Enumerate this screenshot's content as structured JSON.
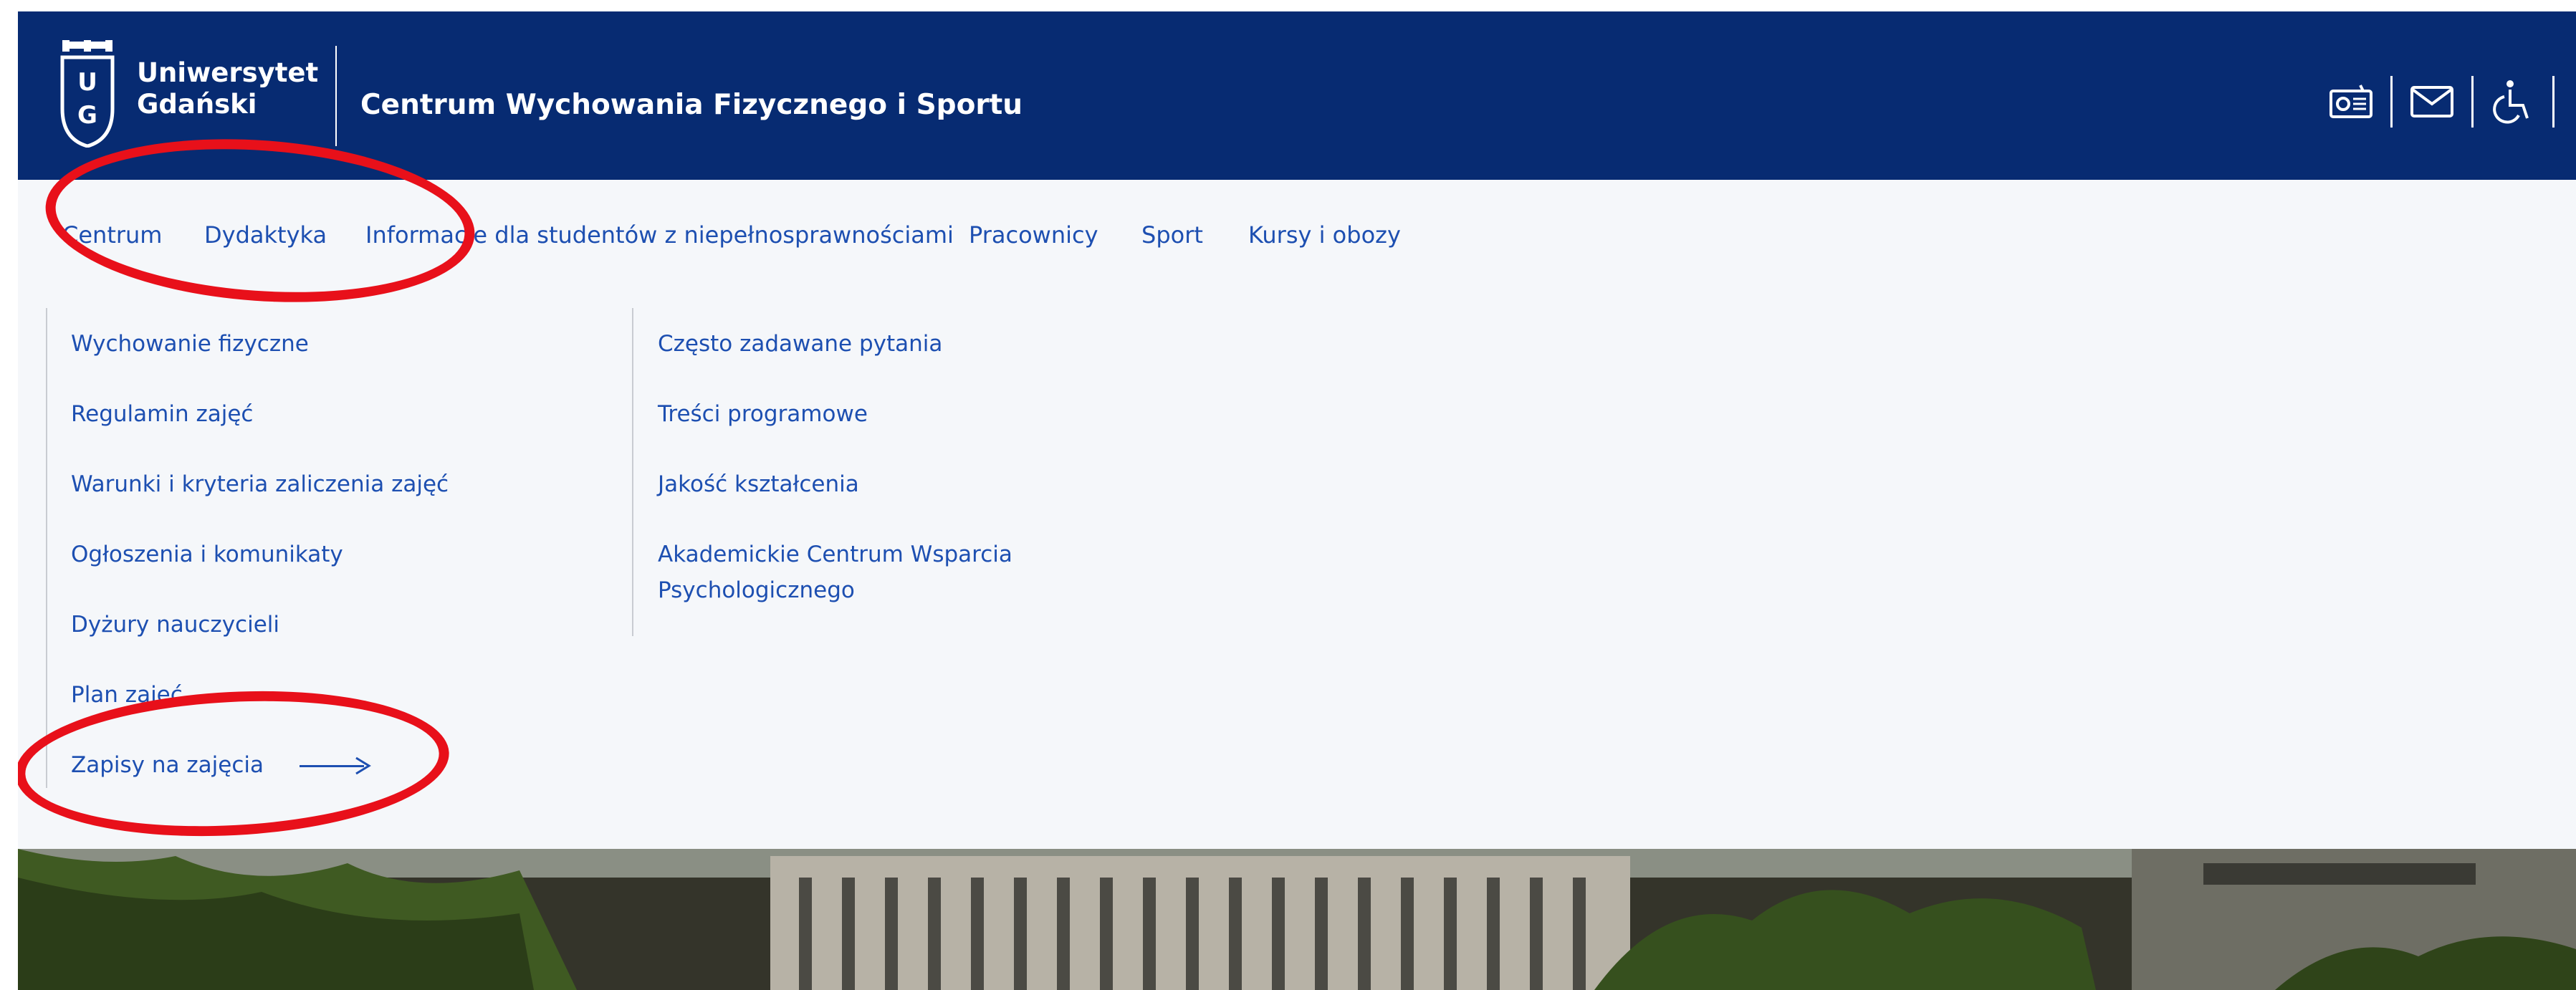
{
  "header": {
    "logo_line1": "Uniwersytet",
    "logo_line2": "Gdański",
    "title": "Centrum Wychowania Fizycznego i Sportu",
    "icons": [
      "radio-icon",
      "mail-icon",
      "accessibility-icon"
    ]
  },
  "nav": {
    "items": [
      {
        "label": "Centrum"
      },
      {
        "label": "Dydaktyka"
      },
      {
        "label": "Informacje dla studentów z niepełnosprawnościami"
      },
      {
        "label": "Pracownicy"
      },
      {
        "label": "Sport"
      },
      {
        "label": "Kursy i obozy"
      }
    ]
  },
  "submenu": {
    "col1": [
      {
        "label": "Wychowanie fizyczne"
      },
      {
        "label": "Regulamin zajęć"
      },
      {
        "label": "Warunki i kryteria zaliczenia zajęć"
      },
      {
        "label": "Ogłoszenia i komunikaty"
      },
      {
        "label": "Dyżury nauczycieli"
      },
      {
        "label": "Plan zajęć"
      },
      {
        "label": "Zapisy na zajęcia"
      }
    ],
    "col2": [
      {
        "label": "Często zadawane pytania"
      },
      {
        "label": "Treści programowe"
      },
      {
        "label": "Jakość kształcenia"
      },
      {
        "label": "Akademickie Centrum Wsparcia"
      },
      {
        "label": "Psychologicznego"
      }
    ]
  },
  "colors": {
    "header_bg": "#072b72",
    "link": "#1d4fb1",
    "annotation": "#e8101a"
  }
}
